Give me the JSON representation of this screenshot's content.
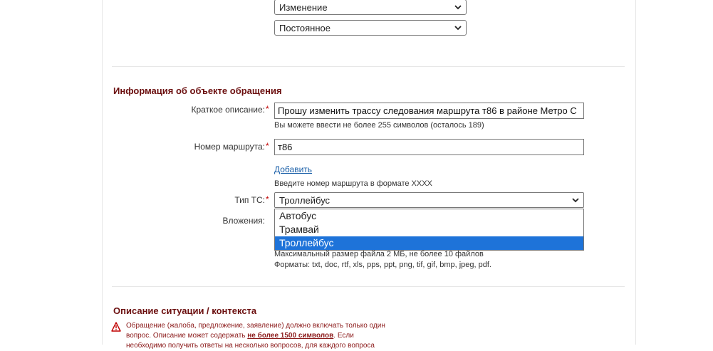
{
  "top_selects": {
    "change_value": "Изменение",
    "permanent_value": "Постоянное"
  },
  "object_section": {
    "title": "Информация об объекте обращения",
    "short_desc_label": "Краткое описание:",
    "short_desc_value": "Прошу изменить трассу следования маршрута т86 в районе Метро С",
    "short_desc_hint": "Вы можете ввести не более 255 символов (осталось 189)",
    "route_label": "Номер маршрута:",
    "route_value": "т86",
    "add_link": "Добавить",
    "route_hint": "Введите номер маршрута в формате XXXX",
    "vehicle_label": "Тип ТС:",
    "vehicle_value": "Троллейбус",
    "vehicle_options": [
      "Автобус",
      "Трамвай",
      "Троллейбус"
    ],
    "attachments_label": "Вложения:",
    "attach_hint_1": "Максимальный размер файла 2 МБ, не более 10 файлов",
    "attach_hint_2": "Форматы: txt, doc, rtf, xls, pps, ppt, png, tif, gif, bmp, jpeg, pdf."
  },
  "context_section": {
    "title": "Описание ситуации / контекста",
    "warn_part1": "Обращение (жалоба, предложение, заявление) должно включать только один вопрос. Описание может содержать ",
    "warn_bold": "не более 1500 символов",
    "warn_part2": ". Если необходимо получить ответы на несколько вопросов, для каждого вопроса"
  },
  "colors": {
    "section_title": "#6b0f0f",
    "required_star": "#c00000",
    "link": "#1a5fa8",
    "selected_option": "#1e73d9",
    "warning_text": "#8b1a1a"
  }
}
